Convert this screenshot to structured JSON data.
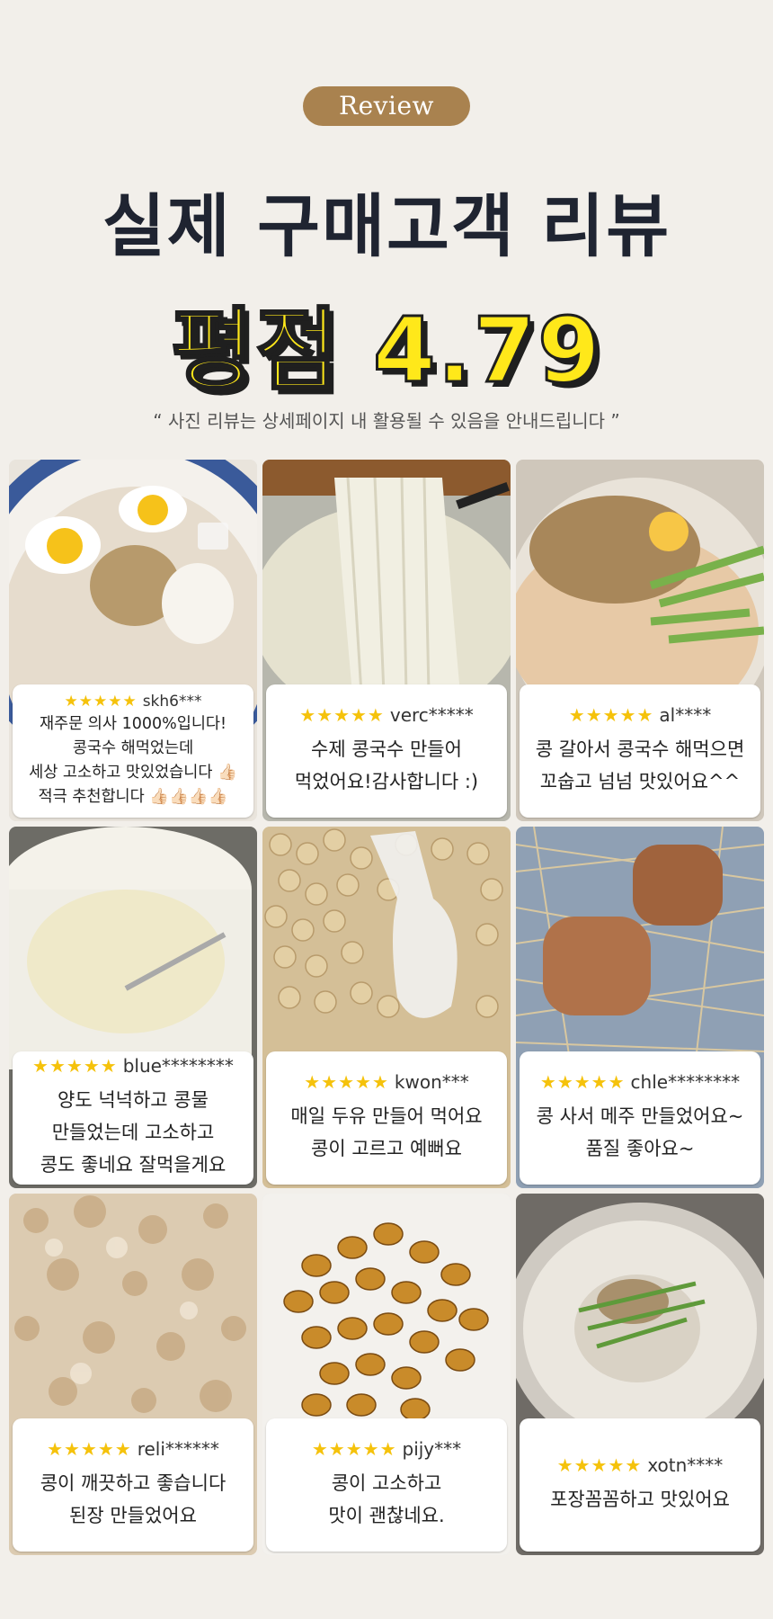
{
  "header": {
    "badge": "Review",
    "title": "실제 구매고객 리뷰",
    "rating": "평점 4.79",
    "notice": "“ 사진 리뷰는 상세페이지 내 활용될 수 있음을 안내드립니다 ”"
  },
  "reviews": [
    {
      "stars": "★★★★★",
      "user": "skh6***",
      "lines": [
        "재주문 의사 1000%입니다!",
        "콩국수 해먹었는데",
        "세상 고소하고 맛있었습니다 👍🏻",
        "적극 추천합니다 👍🏻👍🏻👍🏻👍🏻"
      ],
      "photo": "noodle-soup-with-eggs"
    },
    {
      "stars": "★★★★★",
      "user": "verc*****",
      "lines": [
        "수제 콩국수 만들어",
        "먹었어요!감사합니다 :)"
      ],
      "photo": "noodles-lifted-chopsticks"
    },
    {
      "stars": "★★★★★",
      "user": "al****",
      "lines": [
        "콩 갈아서 콩국수 해먹으면",
        "꼬숩고 넘넘 맛있어요^^"
      ],
      "photo": "noodles-cucumber-sesame"
    },
    {
      "stars": "★★★★★",
      "user": "blue********",
      "lines": [
        "양도 넉넉하고 콩물",
        "만들었는데 고소하고",
        "콩도 좋네요 잘먹을게요"
      ],
      "photo": "soy-milk-mug"
    },
    {
      "stars": "★★★★★",
      "user": "kwon***",
      "lines": [
        "매일 두유 만들어 먹어요",
        "콩이 고르고 예뻐요"
      ],
      "photo": "soybeans-scoop"
    },
    {
      "stars": "★★★★★",
      "user": "chle********",
      "lines": [
        "콩 사서 메주 만들었어요~",
        "품질 좋아요~"
      ],
      "photo": "meju-on-straw"
    },
    {
      "stars": "★★★★★",
      "user": "reli******",
      "lines": [
        "콩이 깨끗하고 좋습니다",
        "된장 만들었어요"
      ],
      "photo": "mashed-beans"
    },
    {
      "stars": "★★★★★",
      "user": "pijy***",
      "lines": [
        "콩이 고소하고",
        "맛이 괜찮네요."
      ],
      "photo": "braised-beans"
    },
    {
      "stars": "★★★★★",
      "user": "xotn****",
      "lines": [
        "포장꼼꼼하고 맛있어요"
      ],
      "photo": "kongguksu-bowl"
    }
  ]
}
